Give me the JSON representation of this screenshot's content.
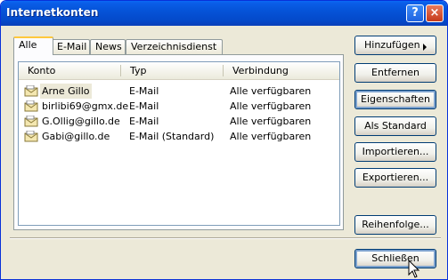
{
  "window": {
    "title": "Internetkonten",
    "help_label": "?",
    "close_label": "×"
  },
  "tabs": [
    {
      "label": "Alle",
      "active": true
    },
    {
      "label": "E-Mail"
    },
    {
      "label": "News"
    },
    {
      "label": "Verzeichnisdienst"
    }
  ],
  "list": {
    "columns": [
      "Konto",
      "Typ",
      "Verbindung"
    ],
    "rows": [
      {
        "konto": "Arne Gillo",
        "typ": "E-Mail",
        "verbindung": "Alle verfügbaren",
        "selected": true
      },
      {
        "konto": "birlibi69@gmx.de",
        "typ": "E-Mail",
        "verbindung": "Alle verfügbaren"
      },
      {
        "konto": "G.Ollig@gillo.de",
        "typ": "E-Mail",
        "verbindung": "Alle verfügbaren"
      },
      {
        "konto": "Gabi@gillo.de",
        "typ": "E-Mail (Standard)",
        "verbindung": "Alle verfügbaren"
      }
    ]
  },
  "buttons": {
    "add": "Hinzufügen",
    "remove": "Entfernen",
    "properties": "Eigenschaften",
    "set_default": "Als Standard",
    "import": "Importieren...",
    "export": "Exportieren...",
    "order": "Reihenfolge...",
    "close": "Schließen"
  },
  "colors": {
    "titlebar": "#0553d8",
    "window_bg": "#ece9d8",
    "tab_highlight": "#ffc83c",
    "selection": "#ece9d8"
  }
}
